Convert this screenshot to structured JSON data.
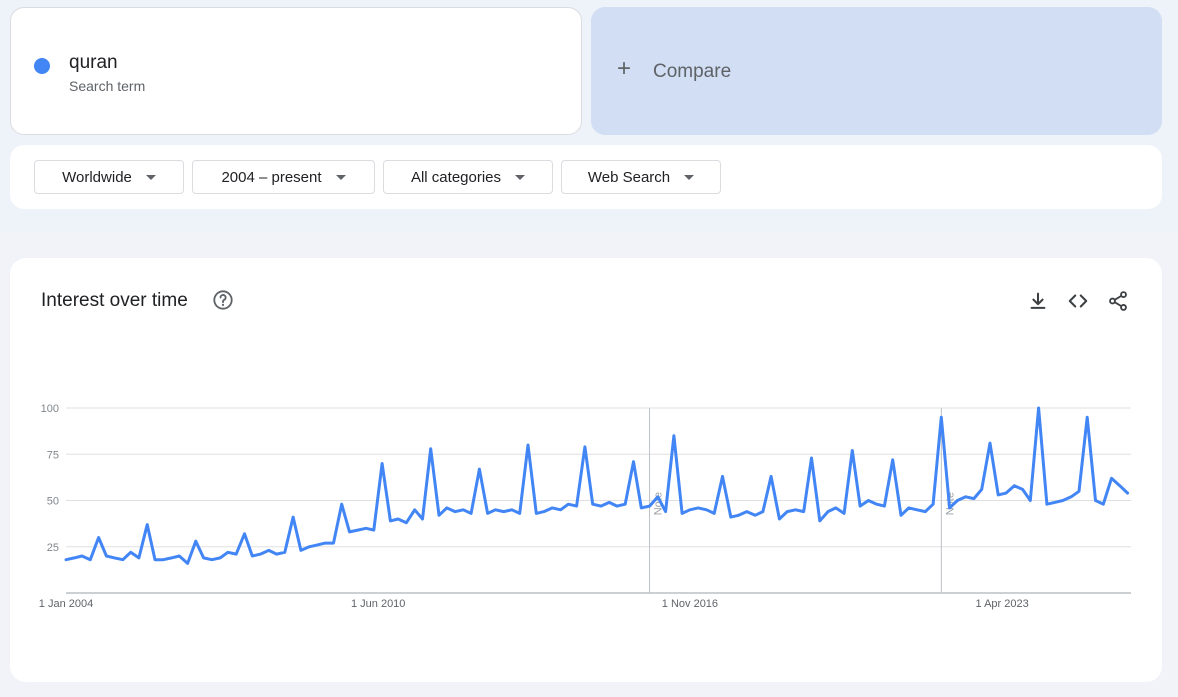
{
  "search": {
    "term": "quran",
    "term_subtitle": "Search term",
    "term_color": "#4285f4",
    "compare_label": "Compare"
  },
  "filters": {
    "region": "Worldwide",
    "time": "2004 – present",
    "category": "All categories",
    "property": "Web Search"
  },
  "chart_header": {
    "title": "Interest over time",
    "icons": [
      "help-icon",
      "download-icon",
      "embed-icon",
      "share-icon"
    ]
  },
  "chart_data": {
    "type": "line",
    "title": "Interest over time",
    "ylim": [
      0,
      100
    ],
    "y_ticks": [
      25,
      50,
      75,
      100
    ],
    "x_tick_labels": [
      "1 Jan 2004",
      "1 Jun 2010",
      "1 Nov 2016",
      "1 Apr 2023"
    ],
    "x_ticks_year": [
      2004.0,
      2010.42,
      2016.83,
      2023.25
    ],
    "x_range_year": [
      2004.0,
      2025.9
    ],
    "grid": true,
    "notes": [
      {
        "label": "Note",
        "x_year": 2016.0
      },
      {
        "label": "Note",
        "x_year": 2022.0
      }
    ],
    "series": [
      {
        "name": "quran",
        "color": "#4285f4",
        "x_year": [
          2004.0,
          2004.17,
          2004.33,
          2004.5,
          2004.67,
          2004.83,
          2005.0,
          2005.17,
          2005.33,
          2005.5,
          2005.67,
          2005.83,
          2006.0,
          2006.17,
          2006.33,
          2006.5,
          2006.67,
          2006.83,
          2007.0,
          2007.17,
          2007.33,
          2007.5,
          2007.67,
          2007.83,
          2008.0,
          2008.17,
          2008.33,
          2008.5,
          2008.67,
          2008.83,
          2009.0,
          2009.17,
          2009.33,
          2009.5,
          2009.67,
          2009.83,
          2010.0,
          2010.17,
          2010.33,
          2010.5,
          2010.67,
          2010.83,
          2011.0,
          2011.17,
          2011.33,
          2011.5,
          2011.67,
          2011.83,
          2012.0,
          2012.17,
          2012.33,
          2012.5,
          2012.67,
          2012.83,
          2013.0,
          2013.17,
          2013.33,
          2013.5,
          2013.67,
          2013.83,
          2014.0,
          2014.17,
          2014.33,
          2014.5,
          2014.67,
          2014.83,
          2015.0,
          2015.17,
          2015.33,
          2015.5,
          2015.67,
          2015.83,
          2016.0,
          2016.17,
          2016.33,
          2016.5,
          2016.67,
          2016.83,
          2017.0,
          2017.17,
          2017.33,
          2017.5,
          2017.67,
          2017.83,
          2018.0,
          2018.17,
          2018.33,
          2018.5,
          2018.67,
          2018.83,
          2019.0,
          2019.17,
          2019.33,
          2019.5,
          2019.67,
          2019.83,
          2020.0,
          2020.17,
          2020.33,
          2020.5,
          2020.67,
          2020.83,
          2021.0,
          2021.17,
          2021.33,
          2021.5,
          2021.67,
          2021.83,
          2022.0,
          2022.17,
          2022.33,
          2022.5,
          2022.67,
          2022.83,
          2023.0,
          2023.17,
          2023.33,
          2023.5,
          2023.67,
          2023.83,
          2024.0,
          2024.17,
          2024.33,
          2024.5,
          2024.67,
          2024.83,
          2025.0,
          2025.17,
          2025.33,
          2025.5,
          2025.67,
          2025.83
        ],
        "values": [
          18,
          19,
          20,
          18,
          30,
          20,
          19,
          18,
          22,
          19,
          37,
          18,
          18,
          19,
          20,
          16,
          28,
          19,
          18,
          19,
          22,
          21,
          32,
          20,
          21,
          23,
          21,
          22,
          41,
          23,
          25,
          26,
          27,
          27,
          48,
          33,
          34,
          35,
          34,
          70,
          39,
          40,
          38,
          45,
          40,
          78,
          42,
          46,
          44,
          45,
          43,
          67,
          43,
          45,
          44,
          45,
          43,
          80,
          43,
          44,
          46,
          45,
          48,
          47,
          79,
          48,
          47,
          49,
          47,
          48,
          71,
          46,
          47,
          52,
          44,
          85,
          43,
          45,
          46,
          45,
          43,
          63,
          41,
          42,
          44,
          42,
          44,
          63,
          40,
          44,
          45,
          44,
          73,
          39,
          44,
          46,
          43,
          77,
          47,
          50,
          48,
          47,
          72,
          42,
          46,
          45,
          44,
          48,
          95,
          46,
          50,
          52,
          51,
          56,
          81,
          53,
          54,
          58,
          56,
          50,
          100,
          48,
          49,
          50,
          52,
          55,
          95,
          50,
          48,
          62,
          58,
          54
        ]
      }
    ]
  }
}
